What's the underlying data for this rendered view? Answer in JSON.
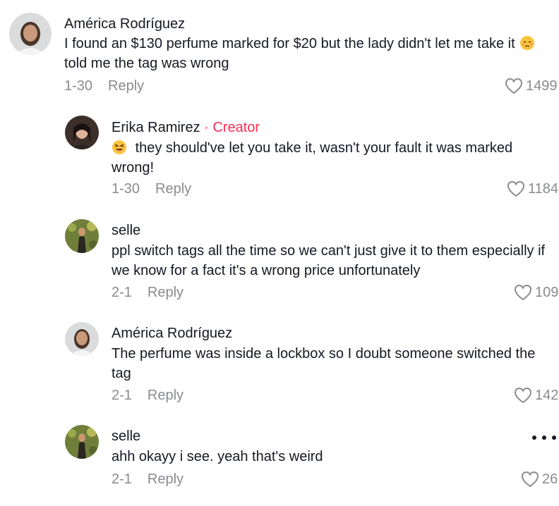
{
  "comments": [
    {
      "author": "América Rodríguez",
      "text_before": "I found an $130 perfume marked for $20 but the lady didn't let me take it",
      "text_after": "told me the tag was wrong",
      "emoji": "pensive-face",
      "date": "1-30",
      "reply_label": "Reply",
      "likes": "1499"
    },
    {
      "author": "Erika Ramirez",
      "badge": "· Creator",
      "emoji": "tired-face",
      "text": "they should've let you take it, wasn't your fault it was marked wrong!",
      "date": "1-30",
      "reply_label": "Reply",
      "likes": "1184"
    },
    {
      "author": "selle",
      "text": "ppl switch tags all the time so we can't just give it to them especially if we know for a fact it's a wrong price unfortunately",
      "date": "2-1",
      "reply_label": "Reply",
      "likes": "109"
    },
    {
      "author": "América Rodríguez",
      "text": "The perfume was inside a lockbox so I doubt someone switched the tag",
      "date": "2-1",
      "reply_label": "Reply",
      "likes": "142"
    },
    {
      "author": "selle",
      "text": "ahh okayy i see. yeah that's weird",
      "date": "2-1",
      "reply_label": "Reply",
      "likes": "26"
    }
  ],
  "colors": {
    "creator_badge": "#fe2c55",
    "meta_text": "#8a8b91",
    "body_text": "#161823"
  }
}
